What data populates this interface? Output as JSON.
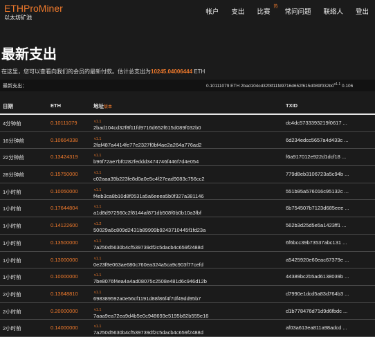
{
  "brand": {
    "title": "ETHProMiner",
    "subtitle": "以太坊矿池"
  },
  "nav": [
    {
      "label": "帐户"
    },
    {
      "label": "支出"
    },
    {
      "label": "比赛",
      "badge": "热"
    },
    {
      "label": "常问问题"
    },
    {
      "label": "联络人"
    },
    {
      "label": "登出"
    }
  ],
  "page": {
    "title": "最新支出",
    "intro_text": "在这里，您可以查看向我们的会员的最新付款。估计总支出为",
    "intro_amount": "10245.04006444",
    "intro_unit": "ETH"
  },
  "ticker": {
    "label": "最新支出：",
    "text": "0.10111079 ETH 2bad104cd32f8f11fd9716d652f615d089f032b0",
    "version": "v1.1",
    "tail": "0.106"
  },
  "table": {
    "headers": {
      "date": "日期",
      "eth": "ETH",
      "address": "地址",
      "address_sub": "版本",
      "txid": "TXID"
    },
    "rows": [
      {
        "date": "4分钟前",
        "eth": "0.10111079",
        "address": "2bad104cd32f8f11fd9716d652f615d089f032b0",
        "version": "v1.1",
        "txid": "dc4dc5733393219f0617 ..."
      },
      {
        "date": "16分钟前",
        "eth": "0.10664338",
        "address": "2faf487a4414fe77e2327f0bf4ae2a264a776ad2",
        "version": "v1.1",
        "txid": "6d234edcc5657a4d433c ..."
      },
      {
        "date": "22分钟前",
        "eth": "0.13424319",
        "address": "b96f72ae7bf0282feddd3474746f446f7d4e054",
        "version": "v1.1",
        "txid": "f6a917012e922d1dcf18 ..."
      },
      {
        "date": "28分钟前",
        "eth": "0.15750000",
        "address": "c02aaa39b223fe8d0a0e5c4f27ead9083c756cc2",
        "version": "v1.1",
        "txid": "779d8eb3106723a5c94b ..."
      },
      {
        "date": "1小时前",
        "eth": "0.10050000",
        "address": "f4eb3ca8b10d8f0531a5a6eeea5b0f327a381146",
        "version": "v1.1",
        "txid": "551b95a576016c95132c ..."
      },
      {
        "date": "1小时前",
        "eth": "0.17644804",
        "address": "a1d8d972560c2f8144af871db508f0b0b10a3fbf",
        "version": "v1.1",
        "txid": "6b754507b7123d685eee ..."
      },
      {
        "date": "1小时前",
        "eth": "0.14122600",
        "address": "50029a6c809d2431b89999b9243710445f1fd23a",
        "version": "v1.2",
        "txid": "562b3d25d5e5a1423ff1 ..."
      },
      {
        "date": "1小时前",
        "eth": "0.13500000",
        "address": "7a250d5630b4cf539739df2c5dacb4c659f2488d",
        "version": "v1.1",
        "txid": "6f6bcc39b73537abc131 ..."
      },
      {
        "date": "1小时前",
        "eth": "0.13000000",
        "address": "0e23f8e063ae680c760ea324a5ca9c903f77cefd",
        "version": "v1.1",
        "txid": "a5425920e60eac67379e ..."
      },
      {
        "date": "1小时前",
        "eth": "0.10000000",
        "address": "7be8076f4ea4a4ad08075c2508e481d6c946d12b",
        "version": "v1.1",
        "txid": "44389bc2b5ad6138039b ..."
      },
      {
        "date": "2小时前",
        "eth": "0.13648810",
        "address": "698389592a0e56cf1191d88f86f4f7df49dd95b7",
        "version": "v1.1",
        "txid": "d7990e1dcd5a83d764b3 ..."
      },
      {
        "date": "2小时前",
        "eth": "0.20000000",
        "address": "7aaa9ea72ea9d4b5e0c948693e5195b82b555e16",
        "version": "v1.1",
        "txid": "d1b778476d71d9d6fbdc ..."
      },
      {
        "date": "2小时前",
        "eth": "0.14000000",
        "address": "7a250d5630b4cf539739df2c5dacb4c659f2488d",
        "version": "v1.1",
        "txid": "af03a613ea811a98adcd ..."
      }
    ]
  }
}
